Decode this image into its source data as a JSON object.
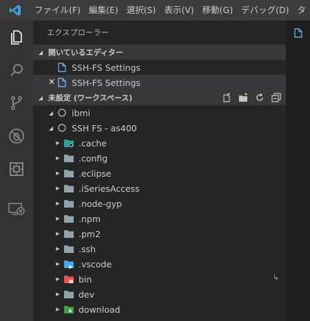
{
  "menu": [
    "ファイル(F)",
    "編集(E)",
    "選択(S)",
    "表示(V)",
    "移動(G)",
    "デバッグ(D)",
    "タ"
  ],
  "sidebar": {
    "title": "エクスプローラー",
    "open_editors": {
      "header": "開いているエディター",
      "items": [
        {
          "label": "SSH-FS Settings",
          "active": false
        },
        {
          "label": "SSH-FS Settings",
          "active": true
        }
      ]
    },
    "workspace": {
      "header": "未設定 (ワークスペース)",
      "roots": [
        {
          "label": "ibmi"
        },
        {
          "label": "SSH FS - as400"
        }
      ],
      "folders": [
        {
          "label": ".cache",
          "icon": "cache-folder-icon",
          "color": "#26a69a"
        },
        {
          "label": ".config",
          "icon": "folder-icon",
          "color": "#90a4ae"
        },
        {
          "label": ".eclipse",
          "icon": "folder-icon",
          "color": "#90a4ae"
        },
        {
          "label": ".iSeriesAccess",
          "icon": "folder-icon",
          "color": "#90a4ae"
        },
        {
          "label": ".node-gyp",
          "icon": "folder-icon",
          "color": "#90a4ae"
        },
        {
          "label": ".npm",
          "icon": "folder-icon",
          "color": "#90a4ae"
        },
        {
          "label": ".pm2",
          "icon": "folder-icon",
          "color": "#90a4ae"
        },
        {
          "label": ".ssh",
          "icon": "folder-icon",
          "color": "#90a4ae"
        },
        {
          "label": ".vscode",
          "icon": "vscode-folder-icon",
          "color": "#42a5f5"
        },
        {
          "label": "bin",
          "icon": "bin-folder-icon",
          "color": "#ef5350",
          "badge": "↳"
        },
        {
          "label": "dev",
          "icon": "folder-icon",
          "color": "#90a4ae"
        },
        {
          "label": "download",
          "icon": "download-folder-icon",
          "color": "#43a047"
        }
      ]
    }
  },
  "colors": {
    "accent": "#75beff",
    "activity_bar": "#333333",
    "sidebar": "#252526",
    "titlebar": "#3c3c3c"
  }
}
